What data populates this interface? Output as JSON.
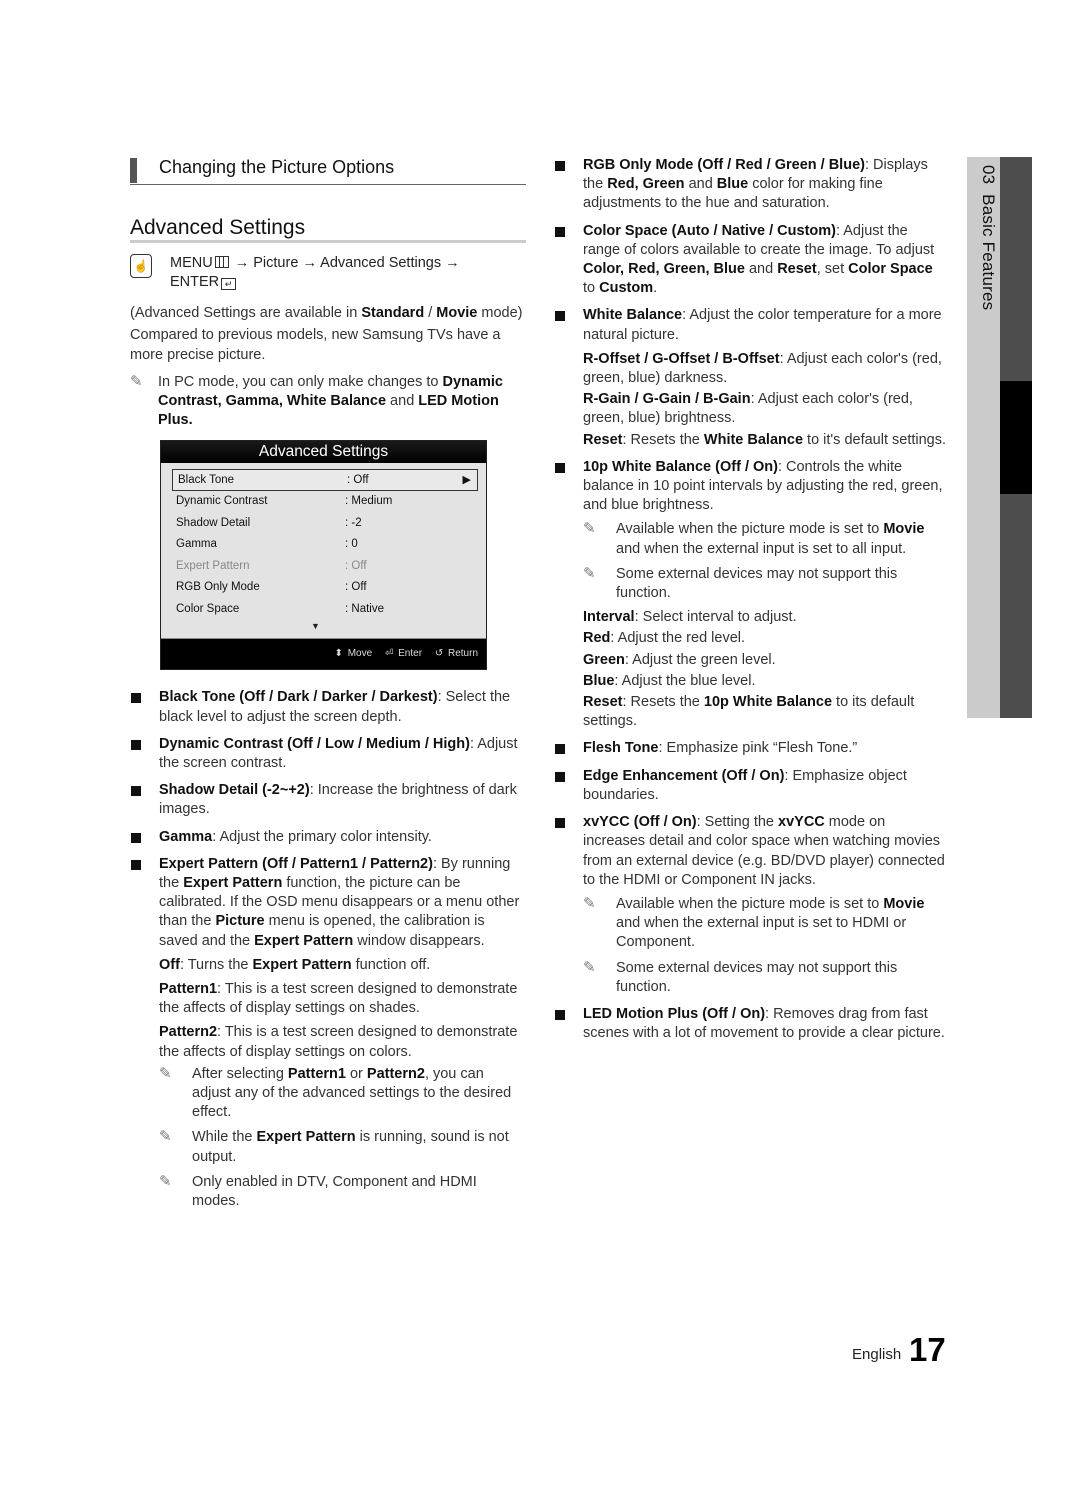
{
  "section": {
    "title": "Changing the Picture Options"
  },
  "heading": "Advanced Settings",
  "menu_path": {
    "menu": "MENU",
    "arrow": "→",
    "picture": "Picture",
    "advanced": "Advanced Settings",
    "enter": "ENTER"
  },
  "intro": {
    "avail_prefix": "(Advanced Settings are available in ",
    "standard": "Standard",
    "slash": " / ",
    "movie": "Movie",
    "avail_suffix": " mode)",
    "compared": "Compared to previous models, new Samsung TVs have a more precise picture."
  },
  "pc_note": {
    "prefix": "In PC mode, you can only make changes to ",
    "items": "Dynamic Contrast, Gamma, White Balance",
    "and": " and ",
    "last": "LED Motion Plus."
  },
  "osd": {
    "title": "Advanced Settings",
    "rows": [
      {
        "label": "Black Tone",
        "value": ": Off"
      },
      {
        "label": "Dynamic Contrast",
        "value": ": Medium"
      },
      {
        "label": "Shadow Detail",
        "value": ": -2"
      },
      {
        "label": "Gamma",
        "value": ": 0"
      },
      {
        "label": "Expert Pattern",
        "value": ": Off"
      },
      {
        "label": "RGB Only Mode",
        "value": ": Off"
      },
      {
        "label": "Color Space",
        "value": ": Native"
      }
    ],
    "footer": {
      "move": "Move",
      "enter": "Enter",
      "return": "Return"
    }
  },
  "left_bullets": {
    "black_tone": {
      "term": "Black Tone (Off / Dark / Darker / Darkest)",
      "desc": ": Select the black level to adjust the screen depth."
    },
    "dynamic_contrast": {
      "term": "Dynamic Contrast (Off / Low / Medium / High)",
      "desc": ": Adjust the screen contrast."
    },
    "shadow_detail": {
      "term": "Shadow Detail (-2~+2)",
      "desc": ": Increase the brightness of dark images."
    },
    "gamma": {
      "term": "Gamma",
      "desc": ": Adjust the primary color intensity."
    },
    "expert_pattern": {
      "term": "Expert Pattern (Off / Pattern1 / Pattern2)",
      "d1": ": By running the ",
      "b1": "Expert Pattern",
      "d2": " function, the picture can be calibrated. If the OSD menu disappears or a menu other than the ",
      "b2": "Picture",
      "d3": " menu is opened, the calibration is saved and the ",
      "b3": "Expert Pattern",
      "d4": " window disappears.",
      "off_term": "Off",
      "off_d1": ": Turns the ",
      "off_b": "Expert Pattern",
      "off_d2": " function off.",
      "p1_term": "Pattern1",
      "p1_desc": ": This is a test screen designed to demonstrate the affects of display settings on shades.",
      "p2_term": "Pattern2",
      "p2_desc": ": This is a test screen designed to demonstrate the affects of display settings on colors.",
      "note1_a": "After selecting ",
      "note1_b1": "Pattern1",
      "note1_or": " or ",
      "note1_b2": "Pattern2",
      "note1_c": ", you can adjust any of the advanced settings to the desired effect.",
      "note2_a": "While the ",
      "note2_b": "Expert Pattern",
      "note2_c": " is running, sound is not output.",
      "note3": "Only enabled in DTV, Component and HDMI modes."
    }
  },
  "right_bullets": {
    "rgb_only": {
      "term": "RGB Only Mode (Off / Red / Green / Blue)",
      "d1": ": Displays the ",
      "b1": "Red, Green",
      "d2": " and ",
      "b2": "Blue",
      "d3": " color for making fine adjustments to the hue and saturation."
    },
    "color_space": {
      "term": "Color Space (Auto / Native / Custom)",
      "d1": ": Adjust the range of colors available to create the image. To adjust ",
      "b1": "Color, Red, Green, Blue",
      "d2": " and ",
      "b2": "Reset",
      "d3": ", set ",
      "b3": "Color Space",
      "d4": " to ",
      "b4": "Custom",
      "d5": "."
    },
    "white_balance": {
      "term": "White Balance",
      "desc": ": Adjust the color temperature for a more natural picture.",
      "offset_term": "R-Offset / G-Offset / B-Offset",
      "offset_desc": ": Adjust each color's (red, green, blue) darkness.",
      "gain_term": "R-Gain / G-Gain / B-Gain",
      "gain_desc": ": Adjust each color's (red, green, blue) brightness.",
      "reset_term": "Reset",
      "reset_d1": ": Resets the ",
      "reset_b": "White Balance",
      "reset_d2": " to it's default settings."
    },
    "wb10": {
      "term": "10p White Balance (Off / On)",
      "desc": ": Controls the white balance in 10 point intervals by adjusting the red, green, and blue brightness.",
      "note1_a": "Available when the picture mode is set to ",
      "note1_b": "Movie",
      "note1_c": " and when the external input is set to all input.",
      "note2": "Some external devices may not support this function.",
      "interval_term": "Interval",
      "interval_desc": ": Select interval to adjust.",
      "red_term": "Red",
      "red_desc": ": Adjust the red level.",
      "green_term": "Green",
      "green_desc": ": Adjust the green level.",
      "blue_term": "Blue",
      "blue_desc": ": Adjust the blue level.",
      "reset_term": "Reset",
      "reset_d1": ": Resets the ",
      "reset_b": "10p White Balance",
      "reset_d2": " to its default settings."
    },
    "flesh_tone": {
      "term": "Flesh Tone",
      "desc": ": Emphasize pink “Flesh Tone.”"
    },
    "edge": {
      "term": "Edge Enhancement (Off / On)",
      "desc": ": Emphasize object boundaries."
    },
    "xvycc": {
      "term": "xvYCC (Off / On)",
      "d1": ": Setting the ",
      "b1": "xvYCC",
      "d2": " mode on increases detail and color space when watching movies from an external device (e.g. BD/DVD player) connected to the HDMI or Component IN jacks.",
      "note1_a": "Available when the picture mode is set to ",
      "note1_b": "Movie",
      "note1_c": " and when the external input is set to HDMI or Component.",
      "note2": "Some external devices may not support this function."
    },
    "led_motion": {
      "term": "LED Motion Plus (Off / On)",
      "desc": ": Removes drag from fast scenes with a lot of movement to provide a clear picture."
    }
  },
  "side_tab": {
    "chapter": "03",
    "label": "Basic Features"
  },
  "footer": {
    "language": "English",
    "page": "17"
  }
}
